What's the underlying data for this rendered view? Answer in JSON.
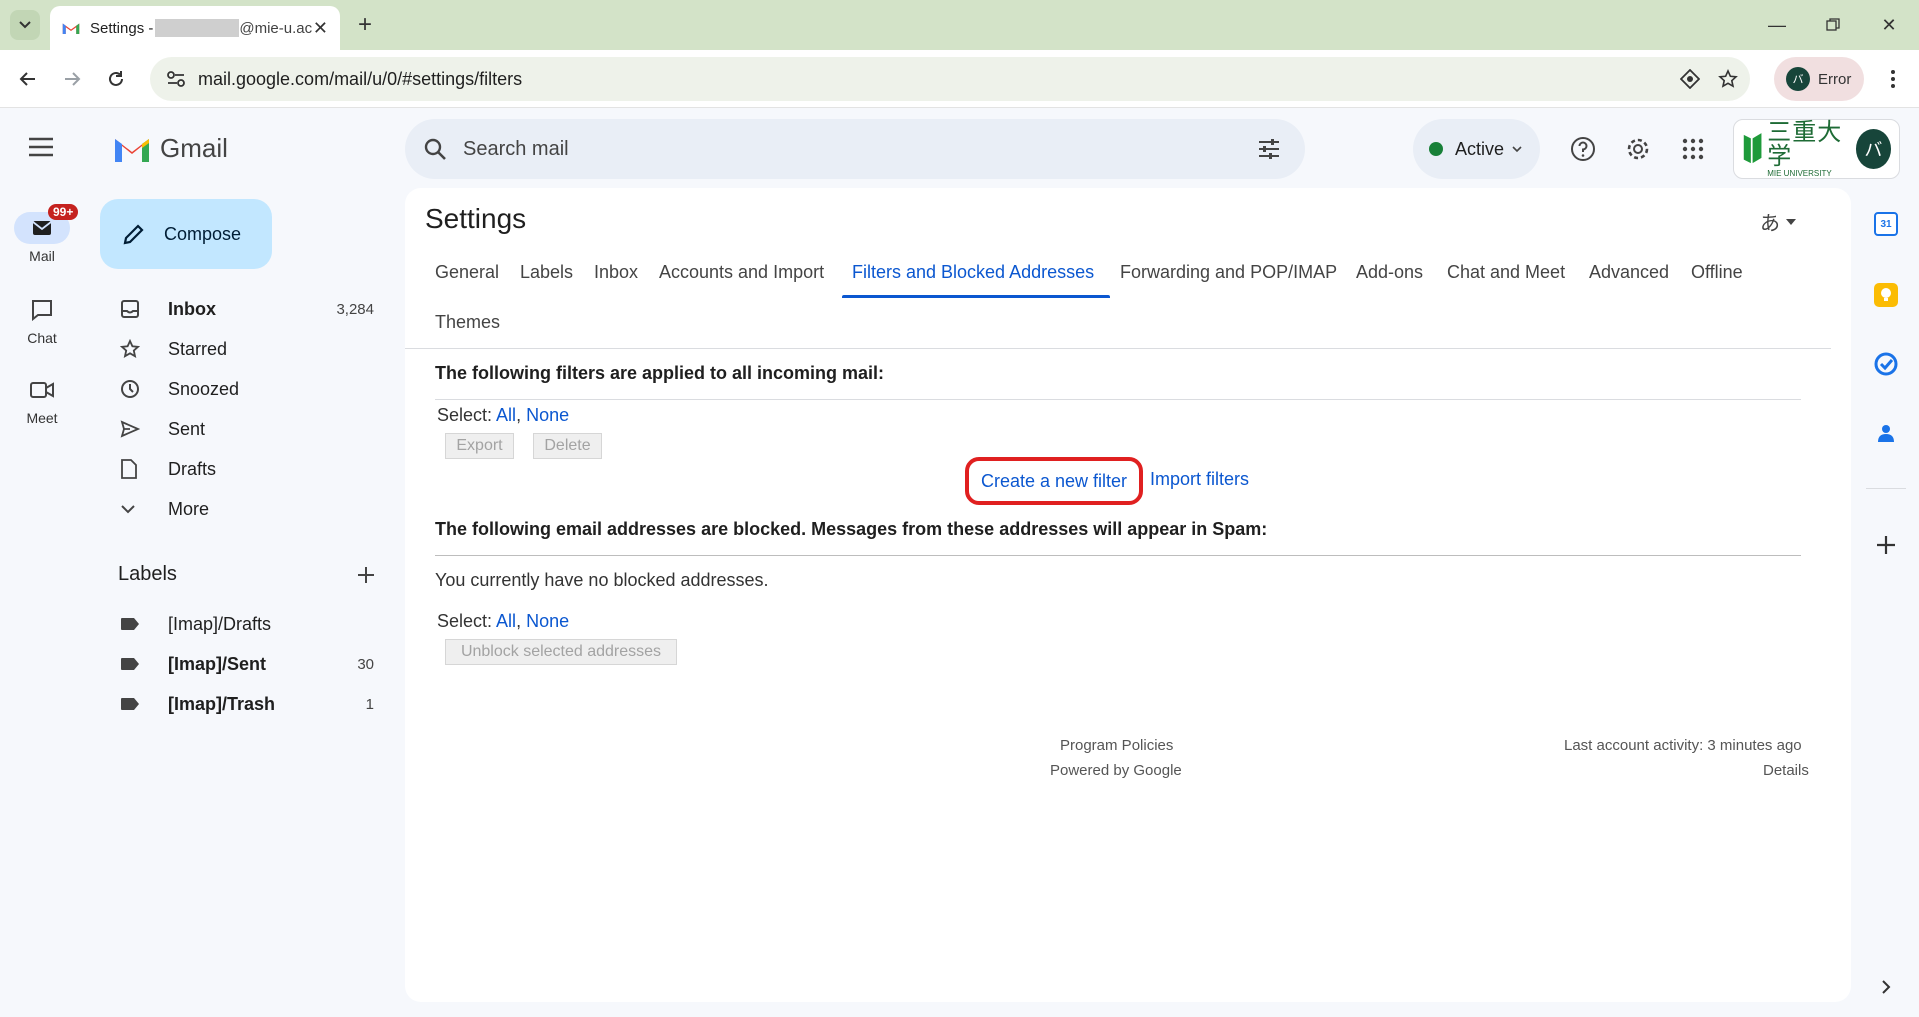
{
  "browser": {
    "tab": {
      "title_prefix": "Settings - ",
      "title_suffix": "@mie-u.ac"
    },
    "address": "mail.google.com/mail/u/0/#settings/filters",
    "profile_status": "Error",
    "profile_initial": "バ"
  },
  "gmail": {
    "product_name": "Gmail",
    "search_placeholder": "Search mail",
    "status": "Active",
    "account_initial": "バ",
    "org_logo_text": "三重大学",
    "org_logo_sub": "MIE UNIVERSITY"
  },
  "left_rail": {
    "items": [
      {
        "label": "Mail",
        "badge": "99+"
      },
      {
        "label": "Chat"
      },
      {
        "label": "Meet"
      }
    ]
  },
  "sidebar": {
    "compose_label": "Compose",
    "nav": [
      {
        "label": "Inbox",
        "count": "3,284"
      },
      {
        "label": "Starred"
      },
      {
        "label": "Snoozed"
      },
      {
        "label": "Sent"
      },
      {
        "label": "Drafts"
      },
      {
        "label": "More"
      }
    ],
    "labels_title": "Labels",
    "labels": [
      {
        "label": "[Imap]/Drafts",
        "count": ""
      },
      {
        "label": "[Imap]/Sent",
        "count": "30"
      },
      {
        "label": "[Imap]/Trash",
        "count": "1"
      }
    ]
  },
  "settings": {
    "title": "Settings",
    "input_tool": "あ",
    "tabs": [
      "General",
      "Labels",
      "Inbox",
      "Accounts and Import",
      "Filters and Blocked Addresses",
      "Forwarding and POP/IMAP",
      "Add-ons",
      "Chat and Meet",
      "Advanced",
      "Offline",
      "Themes"
    ],
    "filters_heading": "The following filters are applied to all incoming mail:",
    "select_label": "Select:",
    "select_all": "All",
    "select_none": "None",
    "export_label": "Export",
    "delete_label": "Delete",
    "create_filter": "Create a new filter",
    "import_filters": "Import filters",
    "blocked_heading": "The following email addresses are blocked. Messages from these addresses will appear in Spam:",
    "no_blocked": "You currently have no blocked addresses.",
    "unblock_label": "Unblock selected addresses"
  },
  "footer": {
    "program_policies": "Program Policies",
    "powered_by": "Powered by Google",
    "last_activity": "Last account activity: 3 minutes ago",
    "details": "Details"
  },
  "colors": {
    "accent": "#0b57d0",
    "compose_bg": "#c2e7ff",
    "highlight_ring": "#e02020",
    "tabbar_bg": "#d3e3c8"
  }
}
